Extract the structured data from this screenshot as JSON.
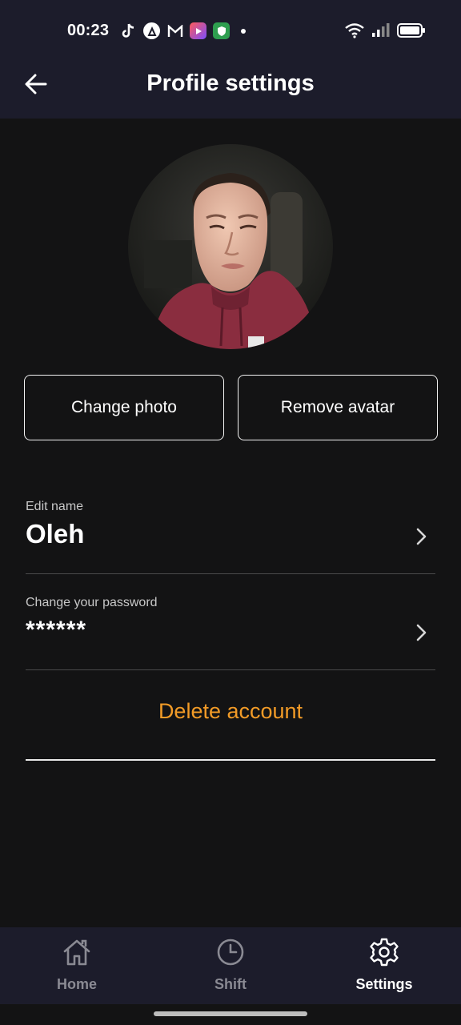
{
  "status_bar": {
    "time": "00:23",
    "notification_icons": [
      "tiktok-icon",
      "vpn-icon",
      "gmail-icon",
      "app-icon",
      "shield-icon"
    ],
    "battery_icon": "battery-icon"
  },
  "app_bar": {
    "title": "Profile settings",
    "back_icon": "arrow-left-icon"
  },
  "profile": {
    "change_photo_label": "Change photo",
    "remove_avatar_label": "Remove avatar",
    "name_label": "Edit name",
    "name_value": "Oleh",
    "password_label": "Change your password",
    "password_value": "******",
    "delete_label": "Delete account"
  },
  "bottom_nav": {
    "items": [
      {
        "label": "Home",
        "icon": "home-icon",
        "active": false
      },
      {
        "label": "Shift",
        "icon": "clock-icon",
        "active": false
      },
      {
        "label": "Settings",
        "icon": "gear-icon",
        "active": true
      }
    ]
  },
  "colors": {
    "background": "#131314",
    "bar": "#1c1c2b",
    "accent": "#f29b27",
    "inactive": "#8a8a93"
  }
}
